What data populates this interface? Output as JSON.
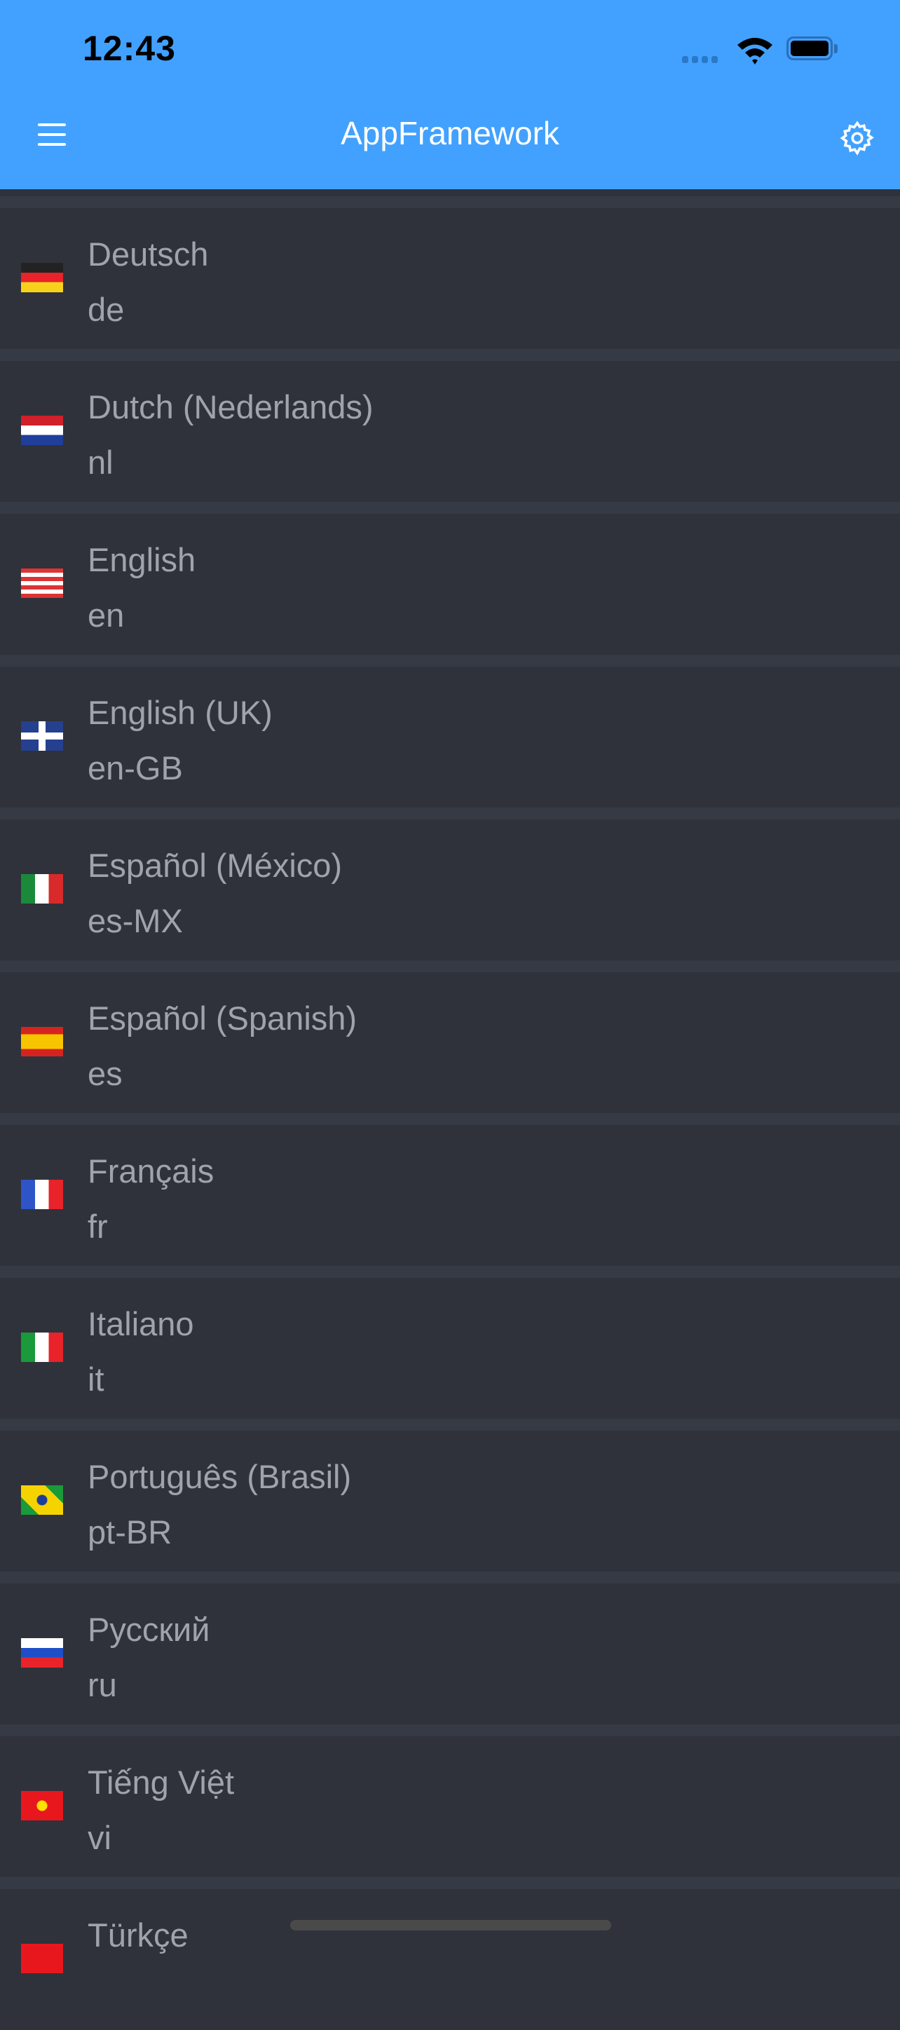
{
  "status_bar": {
    "time": "12:43"
  },
  "nav": {
    "title": "AppFramework",
    "menu_icon": "hamburger-icon",
    "settings_icon": "gear-icon"
  },
  "languages": [
    {
      "name": "Deutsch",
      "code": "de",
      "flag": "germany"
    },
    {
      "name": "Dutch (Nederlands)",
      "code": "nl",
      "flag": "netherlands"
    },
    {
      "name": "English",
      "code": "en",
      "flag": "usa"
    },
    {
      "name": "English (UK)",
      "code": "en-GB",
      "flag": "uk"
    },
    {
      "name": "Español (México)",
      "code": "es-MX",
      "flag": "mexico"
    },
    {
      "name": "Español (Spanish)",
      "code": "es",
      "flag": "spain"
    },
    {
      "name": "Français",
      "code": "fr",
      "flag": "france"
    },
    {
      "name": "Italiano",
      "code": "it",
      "flag": "italy"
    },
    {
      "name": "Português (Brasil)",
      "code": "pt-BR",
      "flag": "brazil"
    },
    {
      "name": "Русский",
      "code": "ru",
      "flag": "russia"
    },
    {
      "name": "Tiếng Việt",
      "code": "vi",
      "flag": "vietnam"
    },
    {
      "name": "Türkçe",
      "code": "",
      "flag": "turkey"
    }
  ],
  "colors": {
    "header": "#42a1ff",
    "background": "#2f323b",
    "divider": "#353a44",
    "text": "#9fa3ab"
  }
}
